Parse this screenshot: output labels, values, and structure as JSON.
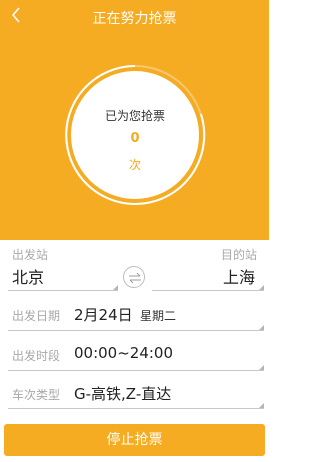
{
  "header": {
    "title": "正在努力抢票"
  },
  "status": {
    "label": "已为您抢票",
    "count": "0",
    "unit": "次"
  },
  "route": {
    "from_label": "出发站",
    "from_value": "北京",
    "to_label": "目的站",
    "to_value": "上海"
  },
  "date": {
    "label": "出发日期",
    "value": "2月24日",
    "weekday": "星期二"
  },
  "time": {
    "label": "出发时段",
    "value": "00:00~24:00"
  },
  "train_type": {
    "label": "车次类型",
    "value": "G-高铁,Z-直达"
  },
  "stop_button": {
    "label": "停止抢票"
  },
  "colors": {
    "accent": "#f5ab22",
    "text": "#222222",
    "label": "#a9a9a9"
  }
}
